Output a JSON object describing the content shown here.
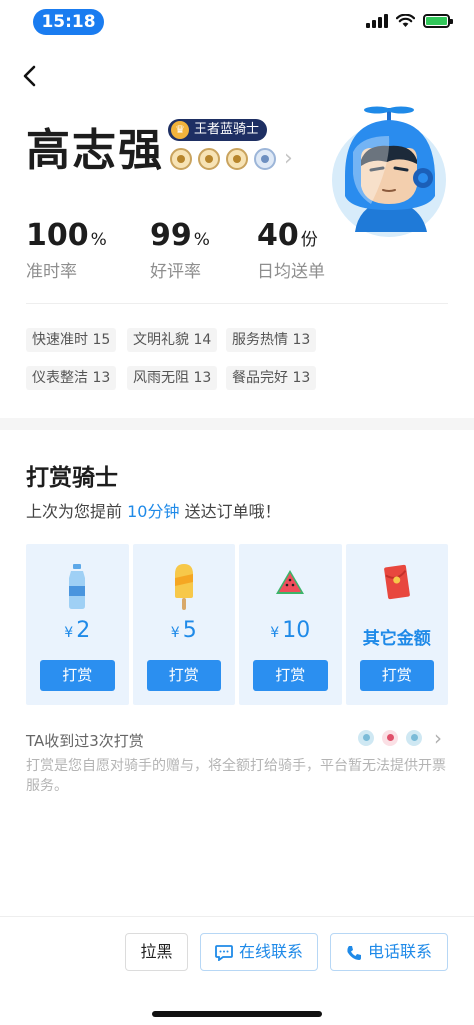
{
  "status_bar": {
    "time": "15:18"
  },
  "rider": {
    "name": "高志强",
    "level_badge": "王者蓝骑士",
    "crown_glyph": "♛"
  },
  "stats": [
    {
      "value": "100",
      "unit": "%",
      "label": "准时率"
    },
    {
      "value": "99",
      "unit": "%",
      "label": "好评率"
    },
    {
      "value": "40",
      "unit": "份",
      "label": "日均送单"
    }
  ],
  "tags": [
    "快速准时 15",
    "文明礼貌 14",
    "服务热情 13",
    "仪表整洁 13",
    "风雨无阻 13",
    "餐品完好 13"
  ],
  "tip": {
    "title": "打赏骑士",
    "subtitle_prefix": "上次为您提前",
    "subtitle_highlight": "10分钟",
    "subtitle_suffix": "送达订单哦！",
    "currency": "¥",
    "options": [
      {
        "icon": "water-bottle-icon",
        "amount": "2",
        "button": "打赏"
      },
      {
        "icon": "popsicle-icon",
        "amount": "5",
        "button": "打赏"
      },
      {
        "icon": "watermelon-icon",
        "amount": "10",
        "button": "打赏"
      },
      {
        "icon": "red-envelope-icon",
        "amount_text": "其它金额",
        "button": "打赏"
      }
    ],
    "received_text": "TA收到过3次打赏",
    "disclaimer": "打赏是您自愿对骑手的赠与，将全额打给骑手，平台暂无法提供开票服务。"
  },
  "bottom": {
    "block_label": "拉黑",
    "chat_label": "在线联系",
    "call_label": "电话联系"
  },
  "colors": {
    "accent": "#1f8ae8",
    "button": "#2b8ff0",
    "card_bg": "#eaf3fd",
    "badge": "#1e2f63"
  }
}
